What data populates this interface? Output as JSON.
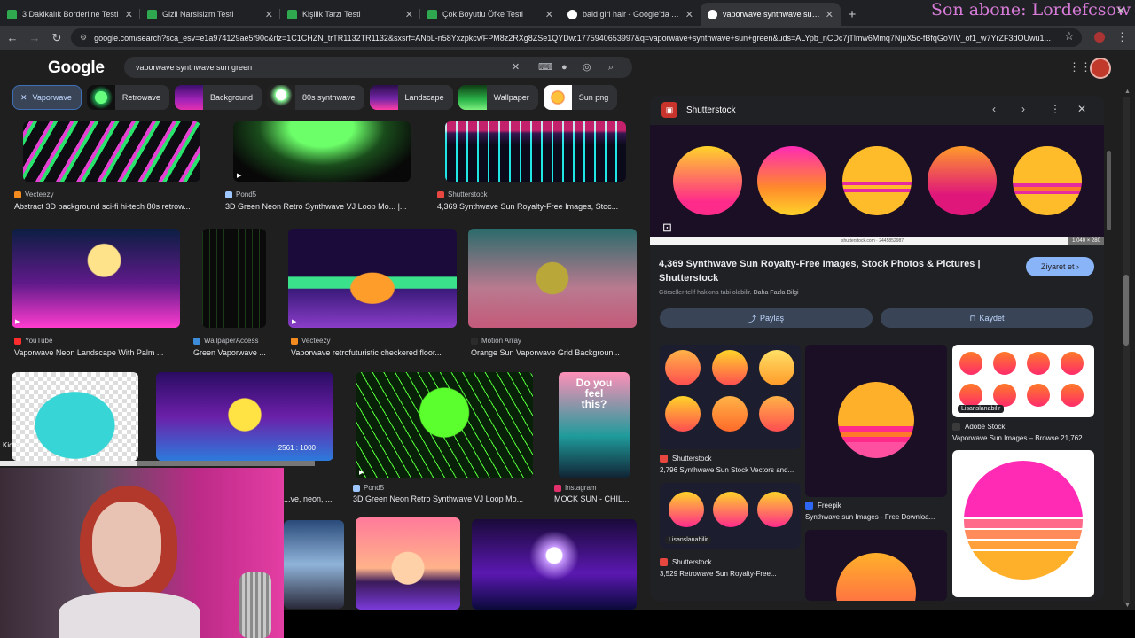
{
  "tabs": [
    {
      "title": "3 Dakikalık Borderline Testi",
      "color": "#2fa84f"
    },
    {
      "title": "Gizli Narsisizm Testi",
      "color": "#2fa84f"
    },
    {
      "title": "Kişilik Tarzı Testi",
      "color": "#2fa84f"
    },
    {
      "title": "Çok Boyutlu Öfke Testi",
      "color": "#2fa84f"
    },
    {
      "title": "bald girl hair - Google'da Ara",
      "color": "#ffffff"
    },
    {
      "title": "vaporwave synthwave sun gree",
      "color": "#ffffff"
    }
  ],
  "overlay": {
    "subscriber_text": "Son abone: Lordefcsow"
  },
  "address_bar": {
    "url": "google.com/search?sca_esv=e1a974129ae5f90c&rlz=1C1CHZN_trTR1132TR1132&sxsrf=ANbL-n58Yxzpkcv/FPM8z2RXg8ZSe1QYDw:1775940653997&q=vaporwave+synthwave+sun+green&uds=ALYpb_nCDc7jTlmw6Mmq7NjuX5c-fBfqGoVIV_of1_w7YrZF3dOUwu1..."
  },
  "google": {
    "logo": "Google",
    "query": "vaporwave synthwave sun green"
  },
  "chips": [
    {
      "label": "Vaporwave",
      "selected": true
    },
    {
      "label": "Retrowave",
      "thumb": "#1e9a4d"
    },
    {
      "label": "Background",
      "thumb": "#a323b9"
    },
    {
      "label": "80s synthwave",
      "thumb": "#3b3b3b"
    },
    {
      "label": "Landscape",
      "thumb": "#7326a6"
    },
    {
      "label": "Wallpaper",
      "thumb": "#2bb54a"
    },
    {
      "label": "Sun png",
      "thumb": "#f27b2e"
    }
  ],
  "results": [
    {
      "source": "Vecteezy",
      "title": "Abstract 3D background sci-fi hi-tech 80s retrow...",
      "fav": "#f38b1f"
    },
    {
      "source": "Pond5",
      "title": "3D Green Neon Retro Synthwave VJ Loop Mo... |...",
      "fav": "#9ec6ff"
    },
    {
      "source": "Shutterstock",
      "title": "4,369 Synthwave Sun Royalty-Free Images, Stoc...",
      "fav": "#e8473f"
    },
    {
      "source": "YouTube",
      "title": "Vaporwave Neon Landscape With Palm ...",
      "fav": "#ff2d2d"
    },
    {
      "source": "WallpaperAccess",
      "title": "Green Vaporwave ...",
      "fav": "#3c8cd9"
    },
    {
      "source": "Vecteezy",
      "title": "Vaporwave retrofuturistic checkered floor...",
      "fav": "#f38b1f"
    },
    {
      "source": "Motion Array",
      "title": "Orange Sun Vaporwave Grid Backgroun...",
      "fav": "#2b2b2b"
    },
    {
      "source": "Pond5",
      "title": "3D Green Neon Retro Synthwave VJ Loop Mo...",
      "fav": "#9ec6ff"
    },
    {
      "source": "Instagram",
      "title": "MOCK SUN - CHIL...",
      "fav": "#e1306c"
    },
    {
      "title": "...ve, neon, ..."
    }
  ],
  "image_text": {
    "do_you_feel_this": "Do you feel this?",
    "dimension": "2561 : 1000"
  },
  "panel": {
    "source": "Shutterstock",
    "dimension": "1,040 × 280",
    "watermark": "shutterstock.com · 2445852987",
    "title": "4,369 Synthwave Sun Royalty-Free Images, Stock Photos & Pictures | Shutterstock",
    "visit": "Ziyaret et",
    "note": "Görseller telif hakkına tabi olabilir.",
    "note_link": "Daha Fazla Bilgi",
    "share": "Paylaş",
    "save": "Kaydet",
    "related": [
      {
        "source": "Shutterstock",
        "title": "2,796 Synthwave Sun Stock Vectors and...",
        "fav": "#e8473f"
      },
      {
        "source": "Freepik",
        "title": "Synthwave sun Images - Free Downloa...",
        "fav": "#2d67f4"
      },
      {
        "source": "Adobe Stock",
        "title": "Vaporwave Sun Images – Browse 21,762...",
        "fav": "#3a3a3a"
      },
      {
        "source": "Shutterstock",
        "title": "3,529 Retrowave Sun Royalty-Free...",
        "fav": "#e8473f"
      }
    ],
    "badge": "Lisanslanabilir"
  },
  "webcam": {
    "kicks": "Kicks"
  }
}
